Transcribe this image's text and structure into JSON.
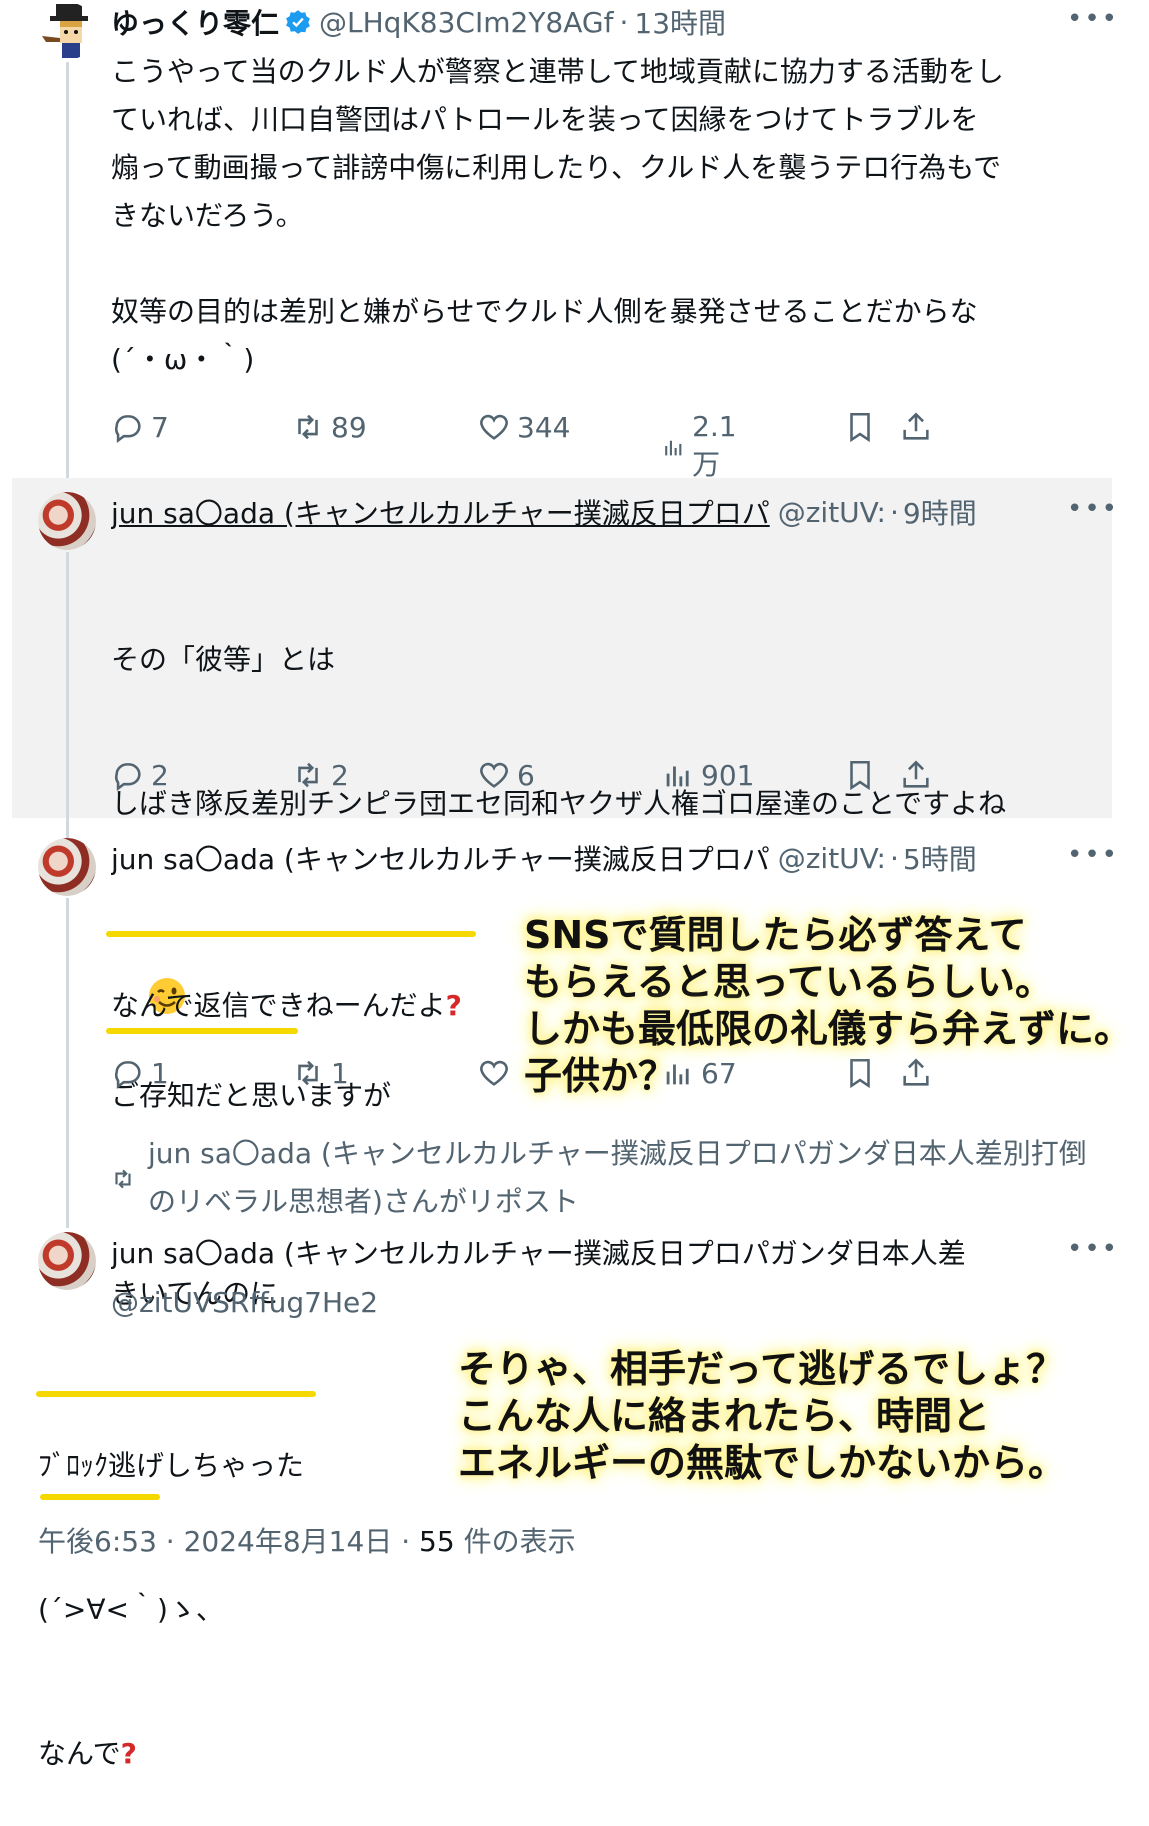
{
  "tweet1": {
    "name": "ゆっくり零仁",
    "handle": "@LHqK83CIm2Y8AGf",
    "time": "13時間",
    "more": "•••",
    "text": "こうやって当のクルド人が警察と連帯して地域貢献に協力する活動をし\nていれば、川口自警団はパトロールを装って因縁をつけてトラブルを\n煽って動画撮って誹謗中傷に利用したり、クルド人を襲うテロ行為もで\nきないだろう。\n\n奴等の目的は差別と嫌がらせでクルド人側を暴発させることだからな\n(´・ω・｀)",
    "replies": "7",
    "reposts": "89",
    "likes": "344",
    "views": "2.1万",
    "verified_color": "#1d9bf0"
  },
  "tweet2": {
    "name": "jun sa〇ada (キャンセルカルチャー撲滅反日プロパ",
    "handle": "@zitUV:",
    "time": "9時間",
    "more": "•••",
    "line1": "その「彼等」とは",
    "line2": "しばき隊反差別チンピラ団エセ同和ヤクザ人権ゴロ屋達のことですよね",
    "emoji": "winking-face",
    "line3": "ご存知だと思いますが",
    "replies": "2",
    "reposts": "2",
    "likes": "6",
    "views": "901"
  },
  "tweet3": {
    "name": "jun sa〇ada (キャンセルカルチャー撲滅反日プロパ",
    "handle": "@zitUV:",
    "time": "5時間",
    "more": "•••",
    "line1": "なんで返信できねーんだよ",
    "line1_mark": "?",
    "line2": "きいてんのに",
    "replies": "1",
    "reposts": "1",
    "views": "67"
  },
  "repost_notice": "jun sa〇ada (キャンセルカルチャー撲滅反日プロパガンダ日本人差別打倒のリベラル思想者)さんがリポスト",
  "tweet4": {
    "name": "jun sa〇ada (キャンセルカルチャー撲滅反日プロパガンダ日本人差",
    "handle": "@zitUVSRffug7He2",
    "more": "•••",
    "line1": "ﾌﾞﾛｯｸ逃げしちゃった",
    "line2": "(´>∀<｀)ゝ、",
    "line3": "なんで",
    "line3_mark": "?",
    "time": "午後6:53",
    "date": "2024年8月14日",
    "view_count": "55",
    "view_label": "件の表示"
  },
  "annotations": {
    "a1": "SNSで質問したら必ず答えて\nもらえると思っているらしい。\nしかも最低限の礼儀すら弁えずに。\n子供か？",
    "a2": "そりゃ、相手だって逃げるでしょ？\nこんな人に絡まれたら、時間と\nエネルギーの無駄でしかないから。",
    "highlight_color": "#fff59a",
    "underline_color": "#f5d800",
    "mark_color": "#d62828"
  }
}
